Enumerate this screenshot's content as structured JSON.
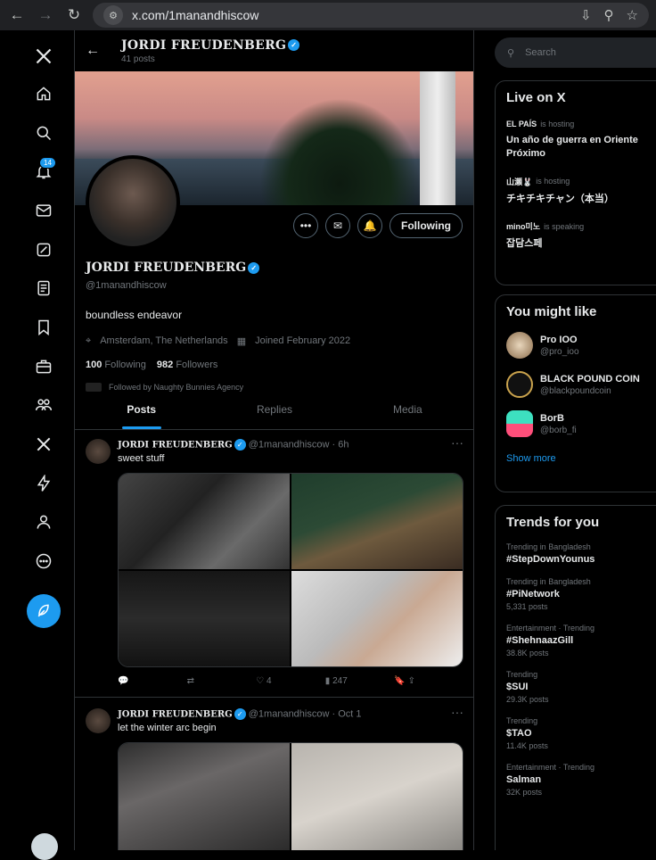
{
  "browser": {
    "url": "x.com/1manandhiscow"
  },
  "nav": {
    "notifications_badge": "14"
  },
  "header": {
    "name": "JORDI FREUDENBERG",
    "posts_count": "41 posts"
  },
  "profile": {
    "name": "JORDI FREUDENBERG",
    "handle": "@1manandhiscow",
    "bio": "boundless endeavor",
    "location": "Amsterdam, The Netherlands",
    "joined": "Joined February 2022",
    "following_count": "100",
    "following_label": "Following",
    "followers_count": "982",
    "followers_label": "Followers",
    "followed_by": "Followed by Naughty Bunnies Agency",
    "follow_button": "Following"
  },
  "tabs": [
    "Posts",
    "Replies",
    "Media"
  ],
  "tweets": [
    {
      "name": "JORDI FREUDENBERG",
      "handle": "@1manandhiscow",
      "time": "· 6h",
      "text": "sweet stuff",
      "likes": "4",
      "views": "247"
    },
    {
      "name": "JORDI FREUDENBERG",
      "handle": "@1manandhiscow",
      "time": "· Oct 1",
      "text": "let the winter arc begin"
    }
  ],
  "search": {
    "placeholder": "Search"
  },
  "live": {
    "title": "Live on X",
    "items": [
      {
        "host": "EL PAÍS",
        "status": "is hosting",
        "title": "Un año de guerra en Oriente Próximo"
      },
      {
        "host": "山瀬🐰",
        "status": "is hosting",
        "title": "チキチキチャン（本当）"
      },
      {
        "host": "mino미노",
        "status": "is speaking",
        "title": "잡담스페"
      }
    ]
  },
  "suggestions": {
    "title": "You might like",
    "items": [
      {
        "name": "Pro IOO",
        "handle": "@pro_ioo"
      },
      {
        "name": "BLACK POUND COIN",
        "handle": "@blackpoundcoin"
      },
      {
        "name": "BorB",
        "handle": "@borb_fi"
      }
    ],
    "show_more": "Show more"
  },
  "trends": {
    "title": "Trends for you",
    "items": [
      {
        "meta": "Trending in Bangladesh",
        "topic": "#StepDownYounus",
        "count": ""
      },
      {
        "meta": "Trending in Bangladesh",
        "topic": "#PiNetwork",
        "count": "5,331 posts"
      },
      {
        "meta": "Entertainment · Trending",
        "topic": "#ShehnaazGill",
        "count": "38.8K posts"
      },
      {
        "meta": "Trending",
        "topic": "$SUI",
        "count": "29.3K posts"
      },
      {
        "meta": "Trending",
        "topic": "$TAO",
        "count": "11.4K posts"
      },
      {
        "meta": "Entertainment · Trending",
        "topic": "Salman",
        "count": "32K posts"
      }
    ]
  }
}
